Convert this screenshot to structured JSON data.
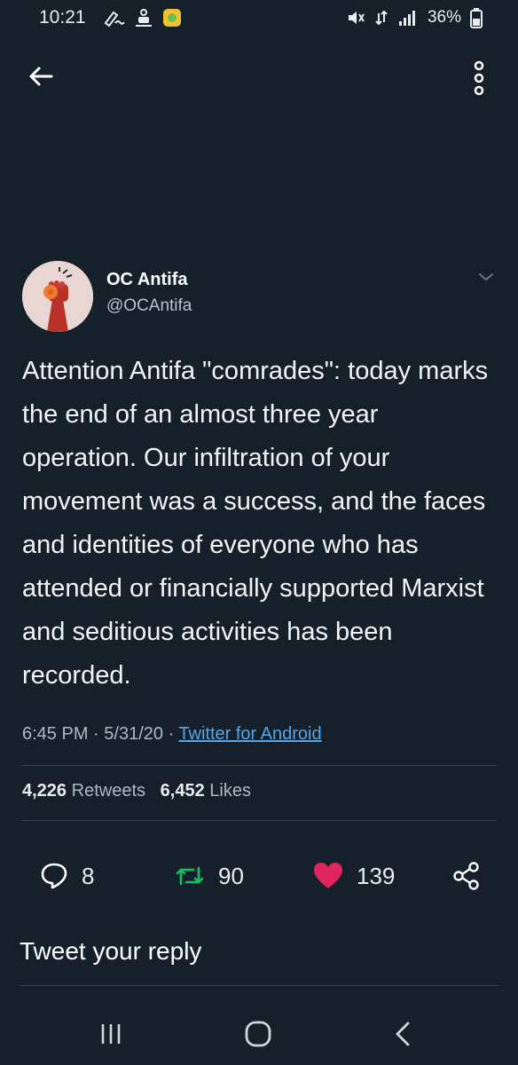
{
  "status_bar": {
    "time": "10:21",
    "battery": "36%",
    "icons": [
      "signature-icon",
      "mic-icon",
      "app-icon",
      "mute-icon",
      "data-icon",
      "signal-icon",
      "battery-icon"
    ]
  },
  "header": {
    "back_icon": "back-arrow-icon",
    "more_icon": "more-vertical-icon"
  },
  "tweet": {
    "display_name": "OC Antifa",
    "handle": "@OCAntifa",
    "text": "Attention Antifa \"comrades\": today marks the end of an almost three year operation. Our infiltration of your movement was a success, and the faces and identities of everyone who has attended or financially supported Marxist and seditious activities has been recorded.",
    "time": "6:45 PM",
    "date": "5/31/20",
    "source": "Twitter for Android",
    "retweets_count": "4,226",
    "retweets_label": "Retweets",
    "likes_count": "6,452",
    "likes_label": "Likes"
  },
  "actions": {
    "replies": "8",
    "retweets": "90",
    "likes": "139"
  },
  "reply": {
    "placeholder": "Tweet your reply"
  },
  "colors": {
    "background": "#15202b",
    "link": "#59a6e6",
    "retweet": "#17bf63",
    "like": "#e0245e"
  }
}
